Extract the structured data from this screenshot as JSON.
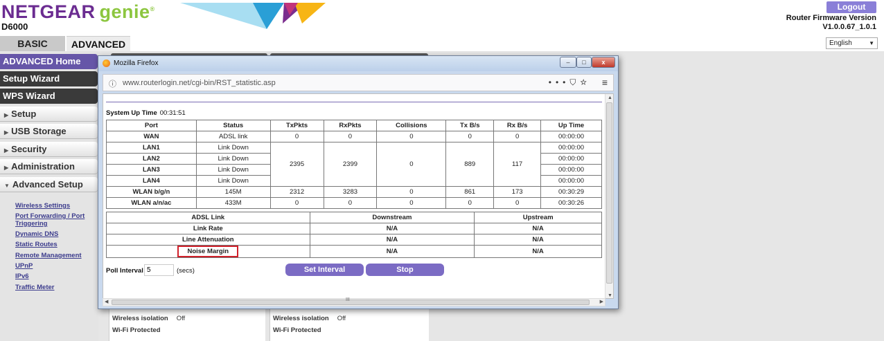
{
  "header": {
    "brand": "NETGEAR",
    "brand_suffix": "genie",
    "model": "D6000",
    "logout_label": "Logout",
    "firmware_label": "Router Firmware Version",
    "firmware_version": "V1.0.0.67_1.0.1",
    "language": "English",
    "tabs": [
      {
        "label": "BASIC"
      },
      {
        "label": "ADVANCED"
      }
    ]
  },
  "sidebar": {
    "top_items": [
      {
        "label": "ADVANCED Home"
      },
      {
        "label": "Setup Wizard"
      },
      {
        "label": "WPS Wizard"
      }
    ],
    "sections": [
      {
        "label": "Setup"
      },
      {
        "label": "USB Storage"
      },
      {
        "label": "Security"
      },
      {
        "label": "Administration"
      },
      {
        "label": "Advanced Setup"
      }
    ],
    "sublinks": [
      "Wireless Settings",
      "Port Forwarding / Port",
      "Triggering",
      "Dynamic DNS",
      "Static Routes",
      "Remote Management",
      "UPnP",
      "IPv6",
      "Traffic Meter"
    ]
  },
  "background_panels": [
    {
      "label": "Wireless isolation",
      "value": "Off",
      "label2": "Wi-Fi Protected"
    },
    {
      "label": "Wireless isolation",
      "value": "Off",
      "label2": "Wi-Fi Protected"
    }
  ],
  "browser": {
    "title": "Mozilla Firefox",
    "url": "www.routerlogin.net/cgi-bin/RST_statistic.asp",
    "win_min": "–",
    "win_max": "□",
    "win_close": "x"
  },
  "stats": {
    "uptime_label": "System Up Time",
    "uptime_value": "00:31:51",
    "headers": [
      "Port",
      "Status",
      "TxPkts",
      "RxPkts",
      "Collisions",
      "Tx B/s",
      "Rx B/s",
      "Up Time"
    ],
    "wan": {
      "port": "WAN",
      "status": "ADSL link",
      "tx": "0",
      "rx": "0",
      "col": "0",
      "txbs": "0",
      "rxbs": "0",
      "up": "00:00:00"
    },
    "lan": [
      {
        "port": "LAN1",
        "status": "Link Down",
        "up": "00:00:00"
      },
      {
        "port": "LAN2",
        "status": "Link Down",
        "up": "00:00:00"
      },
      {
        "port": "LAN3",
        "status": "Link Down",
        "up": "00:00:00"
      },
      {
        "port": "LAN4",
        "status": "Link Down",
        "up": "00:00:00"
      }
    ],
    "lan_shared": {
      "tx": "2395",
      "rx": "2399",
      "col": "0",
      "txbs": "889",
      "rxbs": "117"
    },
    "wlan_bgn": {
      "port": "WLAN b/g/n",
      "status": "145M",
      "tx": "2312",
      "rx": "3283",
      "col": "0",
      "txbs": "861",
      "rxbs": "173",
      "up": "00:30:29"
    },
    "wlan_anac": {
      "port": "WLAN a/n/ac",
      "status": "433M",
      "tx": "0",
      "rx": "0",
      "col": "0",
      "txbs": "0",
      "rxbs": "0",
      "up": "00:30:26"
    }
  },
  "adsl": {
    "headers": [
      "ADSL Link",
      "Downstream",
      "Upstream"
    ],
    "rows": [
      {
        "label": "Link Rate",
        "down": "N/A",
        "up": "N/A"
      },
      {
        "label": "Line Attenuation",
        "down": "N/A",
        "up": "N/A"
      },
      {
        "label": "Noise Margin",
        "down": "N/A",
        "up": "N/A"
      }
    ]
  },
  "poll": {
    "label": "Poll Interval :",
    "value": "5",
    "unit": "(secs)",
    "set_label": "Set Interval",
    "stop_label": "Stop"
  },
  "colors": {
    "brand_purple": "#6b2c91",
    "brand_green": "#8cc63f",
    "button_purple": "#7b6bc4",
    "highlight_red": "#d0202a"
  }
}
